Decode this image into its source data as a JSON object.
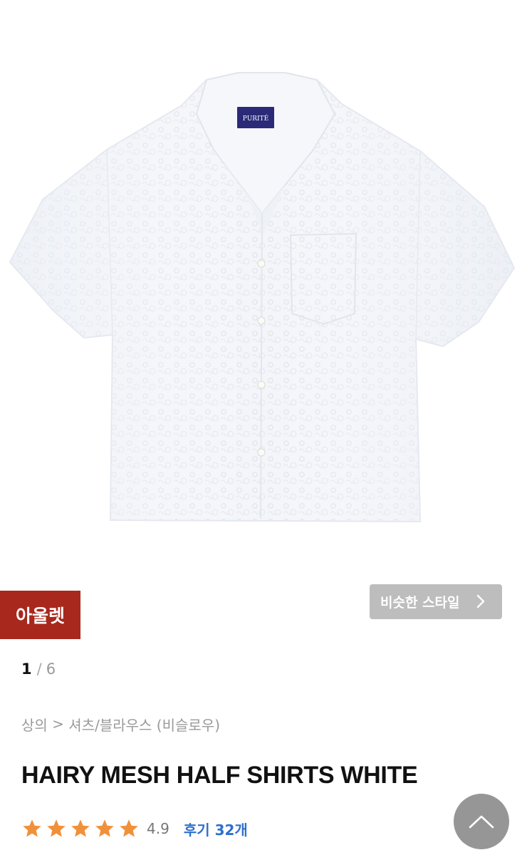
{
  "product": {
    "image_alt": "HAIRY MESH HALF SHIRTS WHITE",
    "label_text": "PURITÉ",
    "outlet_badge": "아울렛",
    "similar_style_label": "비슷한 스타일",
    "pager": {
      "current": "1",
      "separator": "/",
      "total": "6"
    },
    "breadcrumb": {
      "category": "상의",
      "arrow": ">",
      "subcategory": "셔츠/블라우스 (비슬로우)"
    },
    "title": "HAIRY MESH HALF SHIRTS WHITE",
    "rating": {
      "stars": 5,
      "value": "4.9",
      "reviews_label": "후기 32개"
    }
  },
  "colors": {
    "outlet_badge_bg": "#a8281d",
    "similar_button_bg": "#bdbdbd",
    "star": "#f0913a",
    "review_link": "#2f6fce",
    "scroll_top_bg": "#787878"
  },
  "icons": {
    "similar_chevron": "chevron-right-icon",
    "scroll_top": "chevron-up-icon",
    "star": "star-icon"
  }
}
